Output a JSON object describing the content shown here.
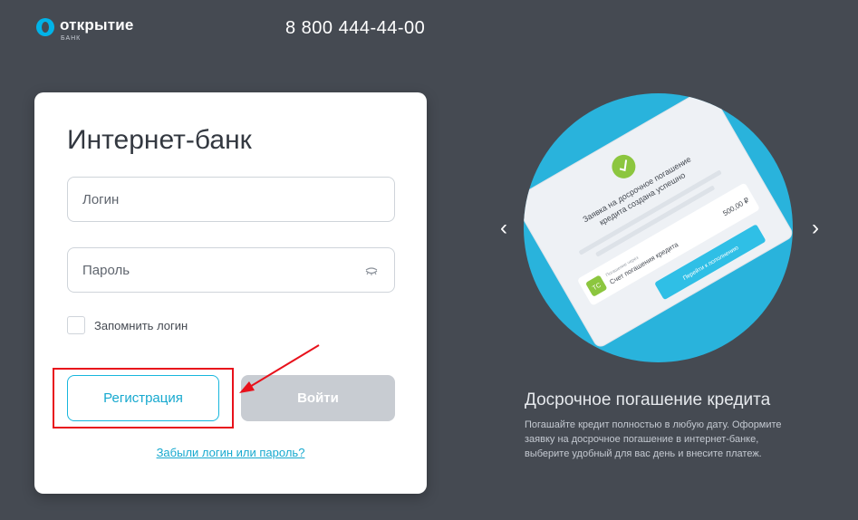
{
  "header": {
    "logo_name": "открытие",
    "logo_sub": "БАНК",
    "phone": "8 800 444-44-00"
  },
  "login_card": {
    "title": "Интернет-банк",
    "login_placeholder": "Логин",
    "password_placeholder": "Пароль",
    "remember_label": "Запомнить логин",
    "register_label": "Регистрация",
    "login_button_label": "Войти",
    "forgot_link": "Забыли логин или пароль?"
  },
  "promo": {
    "illustration": {
      "notice_line1": "Заявка на досрочное погашение",
      "notice_line2": "кредита создана успешно",
      "account_badge": "TC",
      "account_caption": "Погашение через",
      "account_name": "Счет погашения кредита",
      "amount": "500,00 ₽",
      "action_button": "Перейти к пополнению"
    },
    "title": "Досрочное погашение кредита",
    "text": "Погашайте кредит полностью в любую дату. Оформите заявку на досрочное погашение в интернет-банке, выберите удобный для вас день и внесите платеж.",
    "prev_icon": "‹",
    "next_icon": "›"
  },
  "colors": {
    "background": "#454a52",
    "accent": "#17b6dd",
    "annotation": "#e8111b",
    "disabled_button": "#c8ccd2"
  }
}
